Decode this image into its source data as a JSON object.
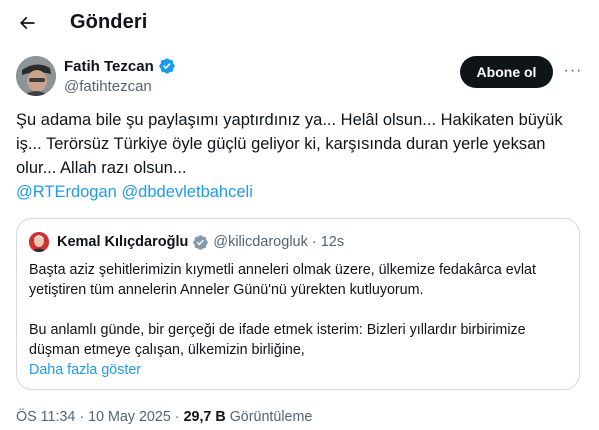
{
  "header": {
    "title": "Gönderi"
  },
  "author": {
    "name": "Fatih Tezcan",
    "handle": "@fatihtezcan",
    "follow_label": "Abone ol",
    "more_label": "···"
  },
  "post": {
    "text": "Şu adama bile şu paylaşımı yaptırdınız ya... Helâl olsun... Hakikaten büyük iş... Terörsüz Türkiye öyle güçlü geliyor ki, karşısında duran yerle yeksan olur... Allah razı olsun...",
    "mentions": [
      "@RTErdogan",
      "@dbdevletbahceli"
    ]
  },
  "quote": {
    "name": "Kemal Kılıçdaroğlu",
    "handle": "@kilicdarogluk",
    "separator": "·",
    "time": "12s",
    "paragraph1": "Başta aziz şehitlerimizin kıymetli anneleri olmak üzere, ülkemize fedakârca evlat yetiştiren tüm annelerin Anneler Günü'nü yürekten kutluyorum.",
    "paragraph2": "Bu anlamlı günde, bir gerçeği de ifade etmek isterim: Bizleri yıllardır birbirimize düşman etmeye çalışan, ülkemizin birliğine,",
    "show_more": "Daha fazla göster"
  },
  "meta": {
    "time": "ÖS 11:34",
    "separator": "·",
    "date": "10 May 2025",
    "separator2": "·",
    "views_count": "29,7 B",
    "views_label": "Görüntüleme"
  },
  "colors": {
    "accent": "#1d9bf0",
    "text": "#0f1419",
    "muted": "#536471",
    "border": "#cfd9de"
  }
}
